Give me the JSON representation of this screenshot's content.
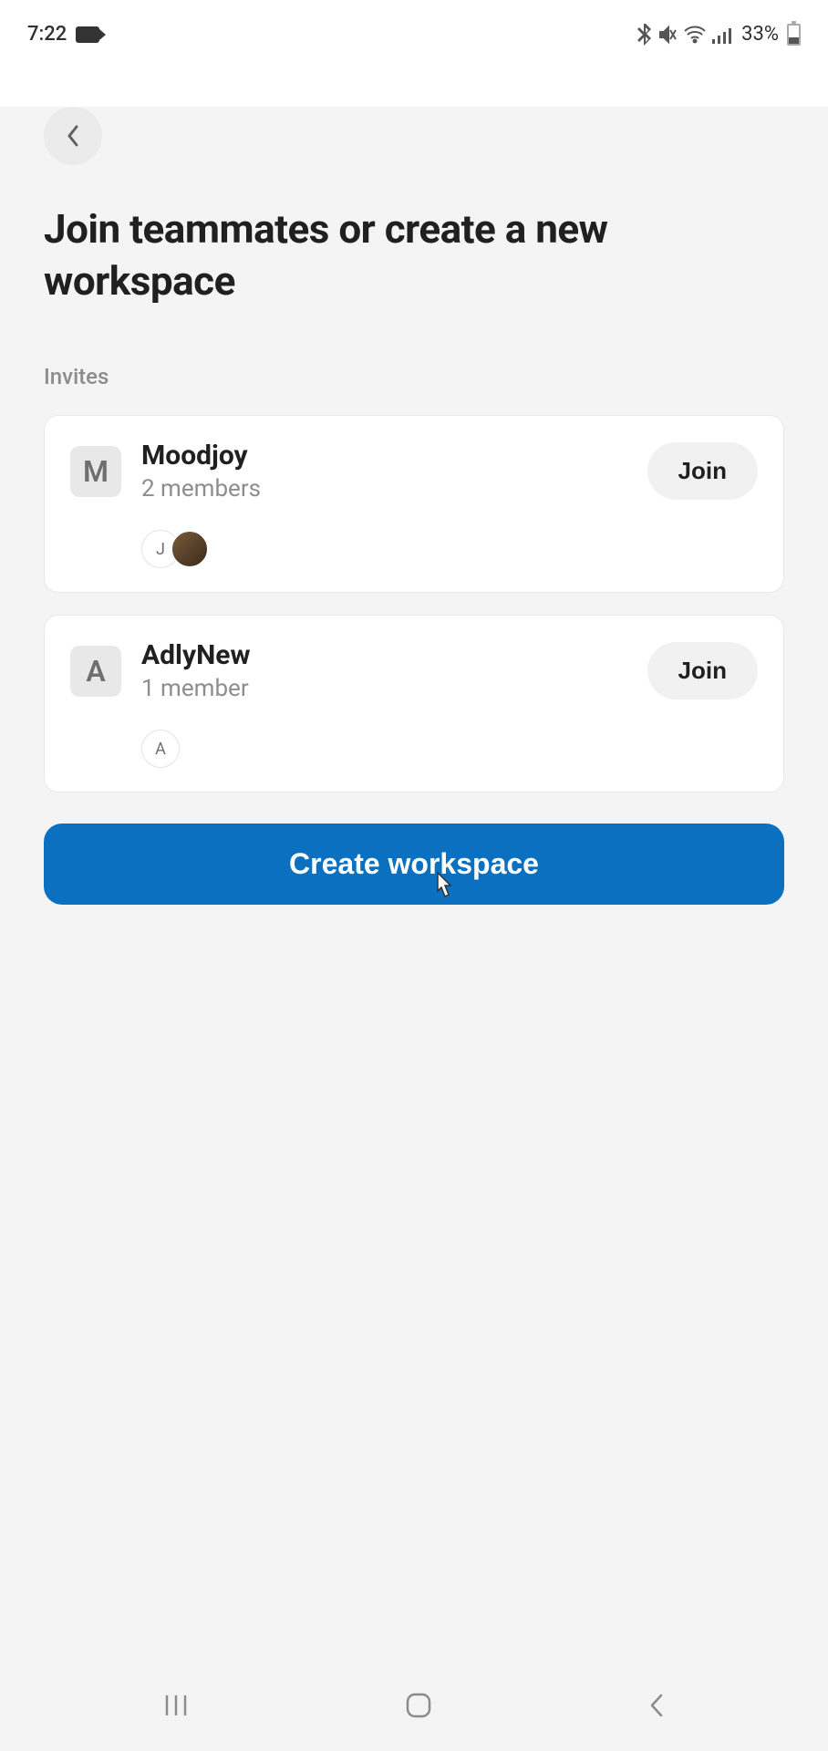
{
  "status": {
    "time": "7:22",
    "battery_percent": "33%"
  },
  "page": {
    "title": "Join teammates or create a new workspace",
    "invites_label": "Invites",
    "create_button": "Create workspace"
  },
  "invites": [
    {
      "avatar_initial": "M",
      "name": "Moodjoy",
      "members_text": "2 members",
      "join_label": "Join",
      "member_avatars": [
        {
          "type": "initial",
          "value": "J"
        },
        {
          "type": "photo",
          "value": ""
        }
      ]
    },
    {
      "avatar_initial": "A",
      "name": "AdlyNew",
      "members_text": "1 member",
      "join_label": "Join",
      "member_avatars": [
        {
          "type": "initial",
          "value": "A"
        }
      ]
    }
  ]
}
